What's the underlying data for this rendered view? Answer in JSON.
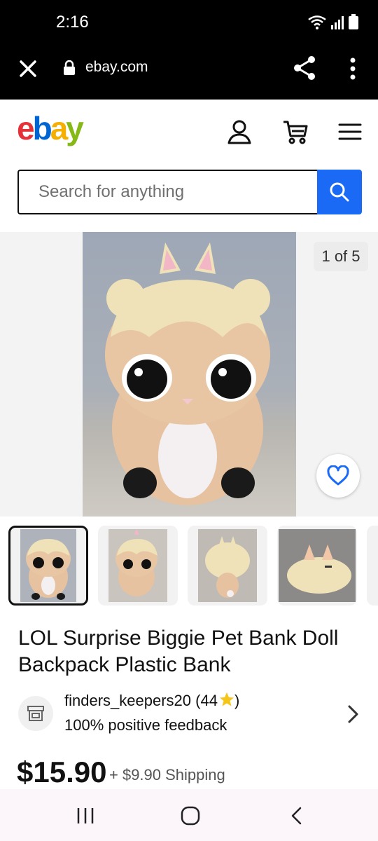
{
  "status_bar": {
    "time": "2:16"
  },
  "browser": {
    "url": "ebay.com"
  },
  "header": {
    "logo": {
      "e": "e",
      "b": "b",
      "a": "a",
      "y": "y"
    }
  },
  "search": {
    "placeholder": "Search for anything"
  },
  "gallery": {
    "counter": "1 of 5",
    "thumbnail_count": 5
  },
  "listing": {
    "title": "LOL Surprise Biggie Pet Bank Doll Backpack Plastic Bank",
    "seller_name": "finders_keepers20",
    "seller_score": "(44",
    "seller_score_close": ")",
    "seller_feedback": "100% positive feedback",
    "price": "$15.90",
    "shipping": "+ $9.90 Shipping"
  },
  "colors": {
    "ebay_red": "#e53238",
    "ebay_blue": "#0064d2",
    "ebay_yellow": "#f5af02",
    "ebay_green": "#86b817",
    "search_button": "#1a6af5",
    "favorite_heart": "#1a6af5"
  },
  "icons": [
    "close-icon",
    "lock-icon",
    "share-icon",
    "more-vert-icon",
    "user-icon",
    "cart-icon",
    "menu-icon",
    "search-icon",
    "heart-icon",
    "store-icon",
    "star-icon",
    "chevron-right-icon",
    "recents-icon",
    "home-icon",
    "back-icon"
  ]
}
